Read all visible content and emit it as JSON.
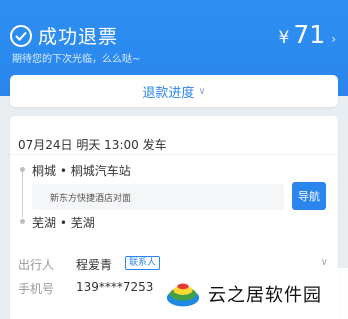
{
  "header": {
    "status_title": "成功退票",
    "subtitle": "期待您的下次光临，么么哒~",
    "currency": "¥",
    "amount": "71",
    "amount_more_icon": "chevron-right-icon"
  },
  "progress": {
    "label": "退款进度",
    "icon": "chevron-down-icon"
  },
  "trip": {
    "depart_line": "07月24日 明天 13:00 发车",
    "from": "桐城 • 桐城汽车站",
    "address": "新东方快捷酒店对面",
    "nav_button": "导航",
    "to": "芜湖 • 芜湖"
  },
  "passenger": {
    "label": "出行人",
    "name": "程爱青",
    "tag": "联系人",
    "phone_label": "手机号",
    "phone": "139****7253"
  },
  "watermark": {
    "text": "云之居软件园"
  },
  "colors": {
    "brand": "#2a86ec",
    "background": "#e9eef3"
  }
}
